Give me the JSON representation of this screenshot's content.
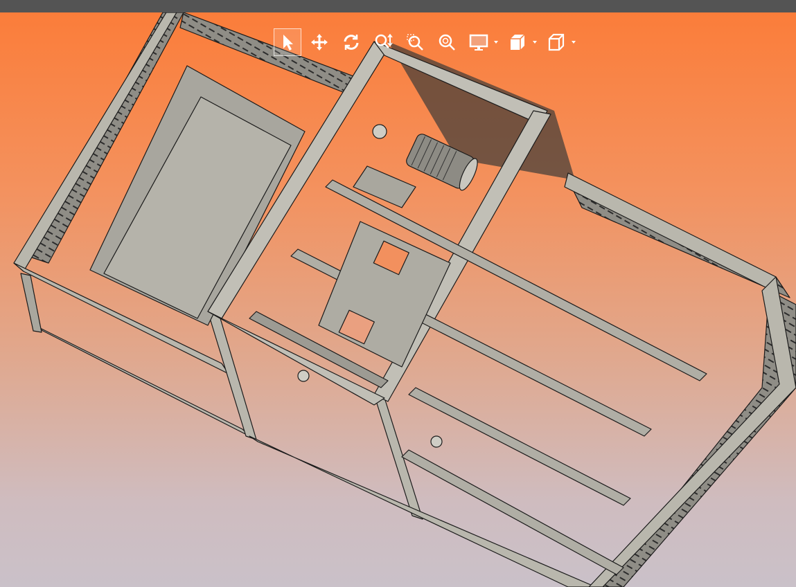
{
  "toolbar": {
    "tools": [
      {
        "name": "select-icon",
        "active": true
      },
      {
        "name": "pan-icon"
      },
      {
        "name": "rotate-icon"
      },
      {
        "name": "zoom-in-out-icon"
      },
      {
        "name": "zoom-window-icon"
      },
      {
        "name": "zoom-fit-icon"
      },
      {
        "name": "display-mode-icon",
        "dropdown": true
      },
      {
        "name": "view-orientation-icon",
        "dropdown": true
      },
      {
        "name": "display-style-icon",
        "dropdown": true
      }
    ]
  },
  "colors": {
    "titlebar": "#545454",
    "bg_top": "#fb7d3a",
    "bg_bottom": "#cac1c9",
    "model": "#b9b7ad"
  }
}
